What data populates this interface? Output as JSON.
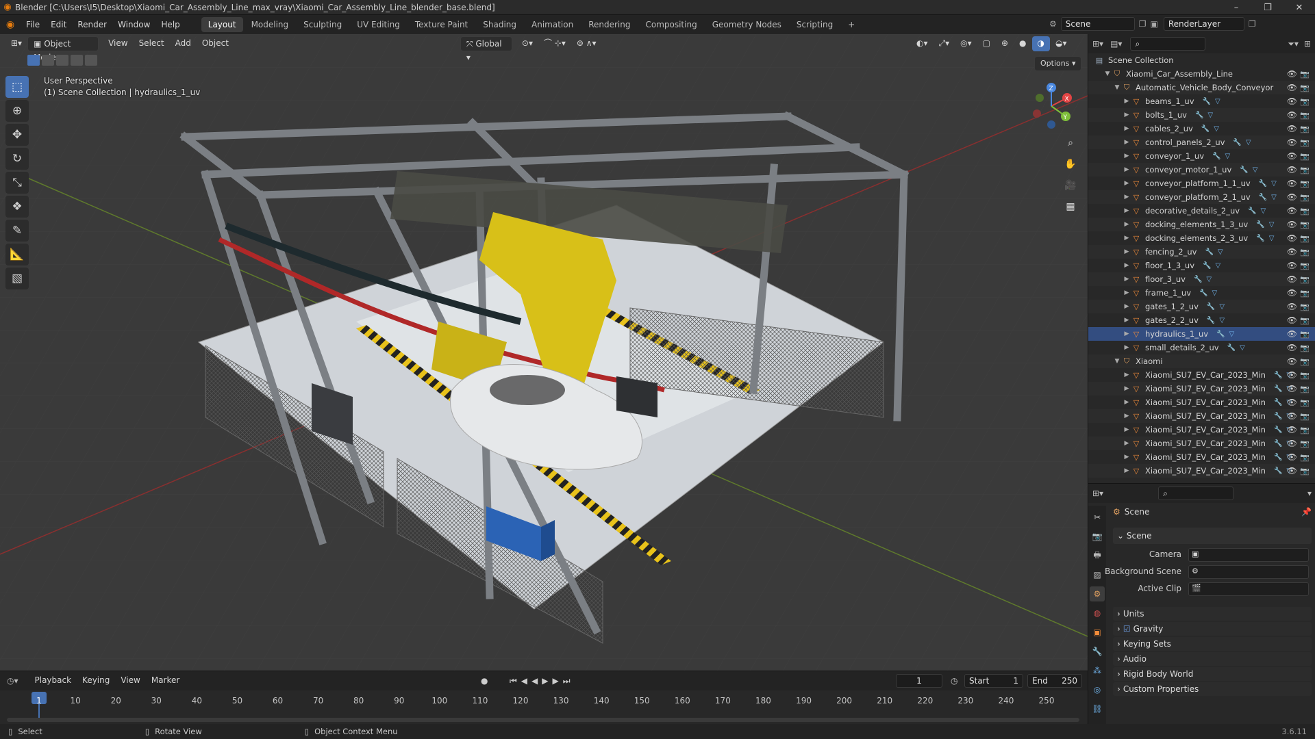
{
  "title_bar": {
    "title": "Blender [C:\\Users\\I5\\Desktop\\Xiaomi_Car_Assembly_Line_max_vray\\Xiaomi_Car_Assembly_Line_blender_base.blend]",
    "minimize": "–",
    "maximize": "❐",
    "close": "✕"
  },
  "menu": {
    "items": [
      "File",
      "Edit",
      "Render",
      "Window",
      "Help"
    ],
    "workspaces": [
      "Layout",
      "Modeling",
      "Sculpting",
      "UV Editing",
      "Texture Paint",
      "Shading",
      "Animation",
      "Rendering",
      "Compositing",
      "Geometry Nodes",
      "Scripting",
      "+"
    ],
    "active_workspace": "Layout",
    "scene_label": "Scene",
    "render_layer_label": "RenderLayer"
  },
  "viewport_header": {
    "mode": "Object Mode",
    "menus": [
      "View",
      "Select",
      "Add",
      "Object"
    ],
    "orientation": "Global",
    "options": "Options"
  },
  "viewport": {
    "perspective": "User Perspective",
    "context": "(1) Scene Collection | hydraulics_1_uv",
    "gizmo_axes": [
      "X",
      "Y",
      "Z"
    ]
  },
  "outliner": {
    "root": "Scene Collection",
    "rows": [
      {
        "label": "Xiaomi_Car_Assembly_Line",
        "kind": "collection",
        "depth": 1,
        "open": true
      },
      {
        "label": "Automatic_Vehicle_Body_Conveyor",
        "kind": "collection",
        "depth": 2,
        "open": true
      },
      {
        "label": "beams_1_uv",
        "kind": "object",
        "depth": 3
      },
      {
        "label": "bolts_1_uv",
        "kind": "object",
        "depth": 3
      },
      {
        "label": "cables_2_uv",
        "kind": "object",
        "depth": 3
      },
      {
        "label": "control_panels_2_uv",
        "kind": "object",
        "depth": 3
      },
      {
        "label": "conveyor_1_uv",
        "kind": "object",
        "depth": 3
      },
      {
        "label": "conveyor_motor_1_uv",
        "kind": "object",
        "depth": 3
      },
      {
        "label": "conveyor_platform_1_1_uv",
        "kind": "object",
        "depth": 3
      },
      {
        "label": "conveyor_platform_2_1_uv",
        "kind": "object",
        "depth": 3
      },
      {
        "label": "decorative_details_2_uv",
        "kind": "object",
        "depth": 3
      },
      {
        "label": "docking_elements_1_3_uv",
        "kind": "object",
        "depth": 3
      },
      {
        "label": "docking_elements_2_3_uv",
        "kind": "object",
        "depth": 3
      },
      {
        "label": "fencing_2_uv",
        "kind": "object",
        "depth": 3
      },
      {
        "label": "floor_1_3_uv",
        "kind": "object",
        "depth": 3
      },
      {
        "label": "floor_3_uv",
        "kind": "object",
        "depth": 3
      },
      {
        "label": "frame_1_uv",
        "kind": "object",
        "depth": 3
      },
      {
        "label": "gates_1_2_uv",
        "kind": "object",
        "depth": 3
      },
      {
        "label": "gates_2_2_uv",
        "kind": "object",
        "depth": 3
      },
      {
        "label": "hydraulics_1_uv",
        "kind": "object",
        "depth": 3,
        "selected": true
      },
      {
        "label": "small_details_2_uv",
        "kind": "object",
        "depth": 3
      },
      {
        "label": "Xiaomi",
        "kind": "collection",
        "depth": 2,
        "open": true
      },
      {
        "label": "Xiaomi_SU7_EV_Car_2023_Min",
        "kind": "object",
        "depth": 3
      },
      {
        "label": "Xiaomi_SU7_EV_Car_2023_Min",
        "kind": "object",
        "depth": 3
      },
      {
        "label": "Xiaomi_SU7_EV_Car_2023_Min",
        "kind": "object",
        "depth": 3
      },
      {
        "label": "Xiaomi_SU7_EV_Car_2023_Min",
        "kind": "object",
        "depth": 3
      },
      {
        "label": "Xiaomi_SU7_EV_Car_2023_Min",
        "kind": "object",
        "depth": 3
      },
      {
        "label": "Xiaomi_SU7_EV_Car_2023_Min",
        "kind": "object",
        "depth": 3
      },
      {
        "label": "Xiaomi_SU7_EV_Car_2023_Min",
        "kind": "object",
        "depth": 3
      },
      {
        "label": "Xiaomi_SU7_EV_Car_2023_Min",
        "kind": "object",
        "depth": 3
      }
    ]
  },
  "properties": {
    "context": "Scene",
    "section_scene": "Scene",
    "camera_label": "Camera",
    "background_scene_label": "Background Scene",
    "active_clip_label": "Active Clip",
    "sections": [
      "Units",
      "Gravity",
      "Keying Sets",
      "Audio",
      "Rigid Body World",
      "Custom Properties"
    ],
    "gravity_checked": true
  },
  "timeline": {
    "menus": [
      "Playback",
      "Keying",
      "View",
      "Marker"
    ],
    "current_frame": "1",
    "start_label": "Start",
    "start": "1",
    "end_label": "End",
    "end": "250",
    "ticks": [
      "1",
      "10",
      "20",
      "30",
      "40",
      "50",
      "60",
      "70",
      "80",
      "90",
      "100",
      "110",
      "120",
      "130",
      "140",
      "150",
      "160",
      "170",
      "180",
      "190",
      "200",
      "210",
      "220",
      "230",
      "240",
      "250"
    ]
  },
  "status_bar": {
    "select": "Select",
    "rotate": "Rotate View",
    "context_menu": "Object Context Menu",
    "version": "3.6.11"
  },
  "colors": {
    "accent": "#4772b3",
    "orange": "#e87d0d",
    "viewport_bg": "#3a3a3a"
  }
}
